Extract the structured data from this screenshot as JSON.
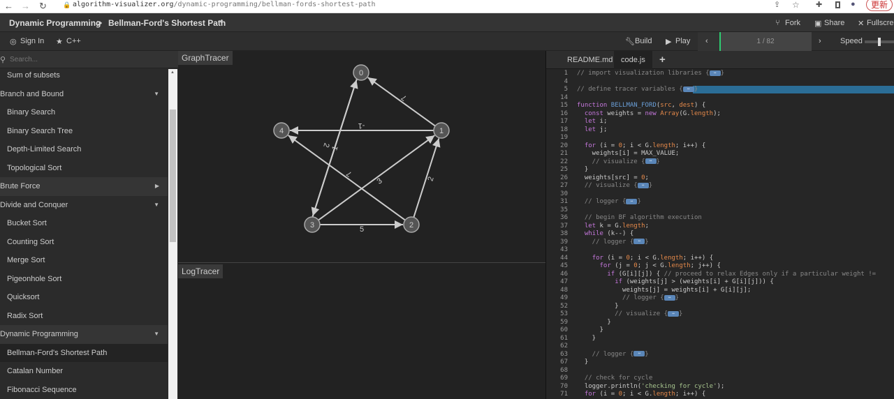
{
  "browser": {
    "url_host": "algorithm-visualizer.org",
    "url_path": "/dynamic-programming/bellman-fords-shortest-path",
    "update_label": "更新"
  },
  "header": {
    "category": "Dynamic Programming",
    "separator": ">",
    "title": "Bellman-Ford's Shortest Path",
    "fork": "Fork",
    "share": "Share",
    "fullscreen": "Fullscreen"
  },
  "toolbar": {
    "sign_in": "Sign In",
    "language": "C++",
    "build": "Build",
    "play": "Play",
    "progress": "1 / 82",
    "progress_fraction": 0.012,
    "speed": "Speed",
    "speed_level": 0.5
  },
  "sidebar": {
    "search_placeholder": "Search...",
    "items": [
      {
        "label": "Sum of subsets",
        "type": "sub"
      },
      {
        "label": "Branch and Bound",
        "type": "cat",
        "caret": "down"
      },
      {
        "label": "Binary Search",
        "type": "sub"
      },
      {
        "label": "Binary Search Tree",
        "type": "sub"
      },
      {
        "label": "Depth-Limited Search",
        "type": "sub"
      },
      {
        "label": "Topological Sort",
        "type": "sub"
      },
      {
        "label": "Brute Force",
        "type": "cat",
        "caret": "right",
        "dark": true
      },
      {
        "label": "Divide and Conquer",
        "type": "cat",
        "caret": "down"
      },
      {
        "label": "Bucket Sort",
        "type": "sub"
      },
      {
        "label": "Counting Sort",
        "type": "sub"
      },
      {
        "label": "Merge Sort",
        "type": "sub"
      },
      {
        "label": "Pigeonhole Sort",
        "type": "sub"
      },
      {
        "label": "Quicksort",
        "type": "sub"
      },
      {
        "label": "Radix Sort",
        "type": "sub"
      },
      {
        "label": "Dynamic Programming",
        "type": "cat",
        "caret": "down",
        "dark": true
      },
      {
        "label": "Bellman-Ford's Shortest Path",
        "type": "sub",
        "active": true
      },
      {
        "label": "Catalan Number",
        "type": "sub"
      },
      {
        "label": "Fibonacci Sequence",
        "type": "sub"
      }
    ]
  },
  "graph": {
    "title": "GraphTracer",
    "nodes": [
      {
        "id": "0"
      },
      {
        "id": "1"
      },
      {
        "id": "2"
      },
      {
        "id": "3"
      },
      {
        "id": "4"
      }
    ],
    "edges": [
      {
        "from": "1",
        "to": "0",
        "weight": "7"
      },
      {
        "from": "1",
        "to": "4",
        "weight": "-1"
      },
      {
        "from": "3",
        "to": "0",
        "weight": "1"
      },
      {
        "from": "0",
        "to": "3",
        "weight": "2"
      },
      {
        "from": "3",
        "to": "1",
        "weight": "3"
      },
      {
        "from": "2",
        "to": "1",
        "weight": "2"
      },
      {
        "from": "2",
        "to": "4",
        "weight": "7"
      },
      {
        "from": "3",
        "to": "2",
        "weight": "5"
      }
    ]
  },
  "log": {
    "title": "LogTracer"
  },
  "editor": {
    "tabs": [
      "README.md",
      "code.js"
    ],
    "add_tab": "+",
    "highlight_line": "5",
    "lines": [
      {
        "n": "1",
        "t": [
          [
            "c",
            "// import visualization libraries {"
          ],
          [
            "fold",
            ""
          ],
          [
            "c",
            "}"
          ]
        ]
      },
      {
        "n": "4",
        "t": []
      },
      {
        "n": "5",
        "t": [
          [
            "c",
            "// define tracer variables {"
          ],
          [
            "fold",
            ""
          ],
          [
            "c",
            "}"
          ]
        ]
      },
      {
        "n": "14",
        "t": []
      },
      {
        "n": "15",
        "t": [
          [
            "k",
            "function "
          ],
          [
            "f",
            "BELLMAN_FORD"
          ],
          [
            "",
            "("
          ],
          [
            "p",
            "src"
          ],
          [
            "",
            ", "
          ],
          [
            "p",
            "dest"
          ],
          [
            "",
            ") {"
          ]
        ]
      },
      {
        "n": "16",
        "t": [
          [
            "",
            "  "
          ],
          [
            "k",
            "const"
          ],
          [
            "",
            " weights = "
          ],
          [
            "k",
            "new "
          ],
          [
            "p",
            "Array"
          ],
          [
            "",
            "(G."
          ],
          [
            "p",
            "length"
          ],
          [
            "",
            ");"
          ]
        ]
      },
      {
        "n": "17",
        "t": [
          [
            "",
            "  "
          ],
          [
            "k",
            "let"
          ],
          [
            "",
            " i;"
          ]
        ]
      },
      {
        "n": "18",
        "t": [
          [
            "",
            "  "
          ],
          [
            "k",
            "let"
          ],
          [
            "",
            " j;"
          ]
        ]
      },
      {
        "n": "19",
        "t": []
      },
      {
        "n": "20",
        "t": [
          [
            "",
            "  "
          ],
          [
            "k",
            "for"
          ],
          [
            "",
            " (i = "
          ],
          [
            "n",
            "0"
          ],
          [
            "",
            "; i < G."
          ],
          [
            "p",
            "length"
          ],
          [
            "",
            "; i++) {"
          ]
        ]
      },
      {
        "n": "21",
        "t": [
          [
            "",
            "    weights[i] = MAX_VALUE;"
          ]
        ]
      },
      {
        "n": "22",
        "t": [
          [
            "c",
            "    // visualize {"
          ],
          [
            "fold",
            ""
          ],
          [
            "c",
            "}"
          ]
        ]
      },
      {
        "n": "25",
        "t": [
          [
            "",
            "  }"
          ]
        ]
      },
      {
        "n": "26",
        "t": [
          [
            "",
            "  weights[src] = "
          ],
          [
            "n",
            "0"
          ],
          [
            "",
            ";"
          ]
        ]
      },
      {
        "n": "27",
        "t": [
          [
            "c",
            "  // visualize {"
          ],
          [
            "fold",
            ""
          ],
          [
            "c",
            "}"
          ]
        ]
      },
      {
        "n": "30",
        "t": []
      },
      {
        "n": "31",
        "t": [
          [
            "c",
            "  // logger {"
          ],
          [
            "fold",
            ""
          ],
          [
            "c",
            "}"
          ]
        ]
      },
      {
        "n": "35",
        "t": []
      },
      {
        "n": "36",
        "t": [
          [
            "c",
            "  // begin BF algorithm execution"
          ]
        ]
      },
      {
        "n": "37",
        "t": [
          [
            "",
            "  "
          ],
          [
            "k",
            "let"
          ],
          [
            "",
            " k = G."
          ],
          [
            "p",
            "length"
          ],
          [
            "",
            ";"
          ]
        ]
      },
      {
        "n": "38",
        "t": [
          [
            "",
            "  "
          ],
          [
            "k",
            "while"
          ],
          [
            "",
            " (k--) {"
          ]
        ]
      },
      {
        "n": "39",
        "t": [
          [
            "c",
            "    // logger {"
          ],
          [
            "fold",
            ""
          ],
          [
            "c",
            "}"
          ]
        ]
      },
      {
        "n": "43",
        "t": []
      },
      {
        "n": "44",
        "t": [
          [
            "",
            "    "
          ],
          [
            "k",
            "for"
          ],
          [
            "",
            " (i = "
          ],
          [
            "n",
            "0"
          ],
          [
            "",
            "; i < G."
          ],
          [
            "p",
            "length"
          ],
          [
            "",
            "; i++) {"
          ]
        ]
      },
      {
        "n": "45",
        "t": [
          [
            "",
            "      "
          ],
          [
            "k",
            "for"
          ],
          [
            "",
            " (j = "
          ],
          [
            "n",
            "0"
          ],
          [
            "",
            "; j < G."
          ],
          [
            "p",
            "length"
          ],
          [
            "",
            "; j++) {"
          ]
        ]
      },
      {
        "n": "46",
        "t": [
          [
            "",
            "        "
          ],
          [
            "k",
            "if"
          ],
          [
            "",
            " (G[i][j]) { "
          ],
          [
            "c",
            "// proceed to relax Edges only if a particular weight !="
          ]
        ]
      },
      {
        "n": "47",
        "t": [
          [
            "",
            "          "
          ],
          [
            "k",
            "if"
          ],
          [
            "",
            " (weights[j] > (weights[i] + G[i][j])) {"
          ]
        ]
      },
      {
        "n": "48",
        "t": [
          [
            "",
            "            weights[j] = weights[i] + G[i][j];"
          ]
        ]
      },
      {
        "n": "49",
        "t": [
          [
            "c",
            "            // logger {"
          ],
          [
            "fold",
            ""
          ],
          [
            "c",
            "}"
          ]
        ]
      },
      {
        "n": "52",
        "t": [
          [
            "",
            "          }"
          ]
        ]
      },
      {
        "n": "53",
        "t": [
          [
            "c",
            "          // visualize {"
          ],
          [
            "fold",
            ""
          ],
          [
            "c",
            "}"
          ]
        ]
      },
      {
        "n": "59",
        "t": [
          [
            "",
            "        }"
          ]
        ]
      },
      {
        "n": "60",
        "t": [
          [
            "",
            "      }"
          ]
        ]
      },
      {
        "n": "61",
        "t": [
          [
            "",
            "    }"
          ]
        ]
      },
      {
        "n": "62",
        "t": []
      },
      {
        "n": "63",
        "t": [
          [
            "c",
            "    // logger {"
          ],
          [
            "fold",
            ""
          ],
          [
            "c",
            "}"
          ]
        ]
      },
      {
        "n": "67",
        "t": [
          [
            "",
            "  }"
          ]
        ]
      },
      {
        "n": "68",
        "t": []
      },
      {
        "n": "69",
        "t": [
          [
            "c",
            "  // check for cycle"
          ]
        ]
      },
      {
        "n": "70",
        "t": [
          [
            "",
            "  logger.println("
          ],
          [
            "s",
            "'checking for cycle'"
          ],
          [
            "",
            ");"
          ]
        ]
      },
      {
        "n": "71",
        "t": [
          [
            "",
            "  "
          ],
          [
            "k",
            "for"
          ],
          [
            "",
            " (i = "
          ],
          [
            "n",
            "0"
          ],
          [
            "",
            "; i < G."
          ],
          [
            "p",
            "length"
          ],
          [
            "",
            "; i++) {"
          ]
        ]
      }
    ]
  },
  "colors": {
    "accent": "#2ecc71",
    "highlight": "#2b6d96",
    "node_fill": "#555555",
    "edge": "#cccccc"
  }
}
